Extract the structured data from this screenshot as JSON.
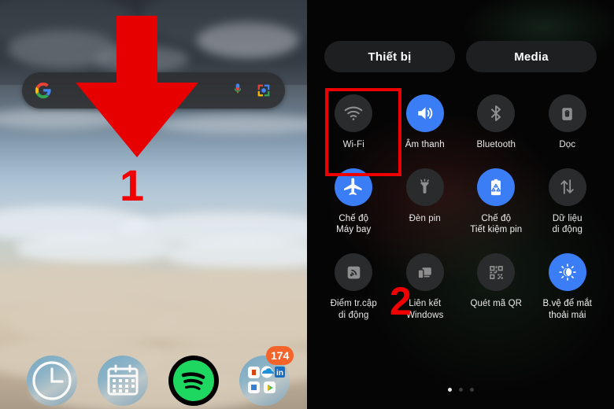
{
  "home": {
    "search": {
      "name": "google-search-bar",
      "placeholder": "",
      "value": "",
      "google_icon": "google-g-icon",
      "mic_icon": "microphone-icon",
      "lens_icon": "google-lens-icon"
    },
    "dock": [
      {
        "name": "clock-app",
        "label": "Clock",
        "icon": "clock-icon"
      },
      {
        "name": "calendar-app",
        "label": "Calendar",
        "icon": "calendar-icon"
      },
      {
        "name": "spotify-app",
        "label": "Spotify",
        "icon": "spotify-icon"
      },
      {
        "name": "apps-folder",
        "label": "Folder",
        "icon": "folder-icon",
        "badge": "174"
      }
    ],
    "annotations": {
      "arrow": {
        "name": "swipe-down-arrow",
        "direction": "down",
        "color": "#e60000"
      },
      "step_one": "1"
    }
  },
  "panel": {
    "tabs": [
      {
        "name": "tab-devices",
        "label": "Thiết bị",
        "selected": true
      },
      {
        "name": "tab-media",
        "label": "Media",
        "selected": false
      }
    ],
    "tiles": [
      {
        "name": "quick-tile-wifi",
        "label": "Wi-Fi",
        "icon": "wifi-icon",
        "active": false
      },
      {
        "name": "quick-tile-sound",
        "label": "Âm thanh",
        "icon": "volume-icon",
        "active": true
      },
      {
        "name": "quick-tile-bluetooth",
        "label": "Bluetooth",
        "icon": "bluetooth-icon",
        "active": false
      },
      {
        "name": "quick-tile-rotation-lock",
        "label": "Dọc",
        "icon": "rotation-lock-icon",
        "active": false
      },
      {
        "name": "quick-tile-airplane-mode",
        "label": "Chế độ\nMáy bay",
        "icon": "airplane-icon",
        "active": true,
        "highlighted": true
      },
      {
        "name": "quick-tile-flashlight",
        "label": "Đèn pin",
        "icon": "flashlight-icon",
        "active": false
      },
      {
        "name": "quick-tile-power-saving",
        "label": "Chế độ\nTiết kiệm pin",
        "icon": "battery-saver-icon",
        "active": true
      },
      {
        "name": "quick-tile-mobile-data",
        "label": "Dữ liệu\ndi động",
        "icon": "mobile-data-icon",
        "active": false
      },
      {
        "name": "quick-tile-hotspot",
        "label": "Điểm tr.cập\ndi động",
        "icon": "hotspot-icon",
        "active": false
      },
      {
        "name": "quick-tile-link-to-windows",
        "label": "Liên kết\nWindows",
        "icon": "link-windows-icon",
        "active": false
      },
      {
        "name": "quick-tile-qr-scanner",
        "label": "Quét mã QR",
        "icon": "qr-code-icon",
        "active": false
      },
      {
        "name": "quick-tile-eye-comfort",
        "label": "B.vệ để mắt\nthoải mái",
        "icon": "eye-comfort-icon",
        "active": true
      }
    ],
    "page_dots": {
      "count": 3,
      "active_index": 0
    },
    "annotations": {
      "step_two": "2"
    }
  },
  "colors": {
    "accent_blue": "#3b7df5",
    "annotation_red": "#ef0000",
    "tile_off": "#2a2b2c",
    "panel_bg": "#050505"
  }
}
